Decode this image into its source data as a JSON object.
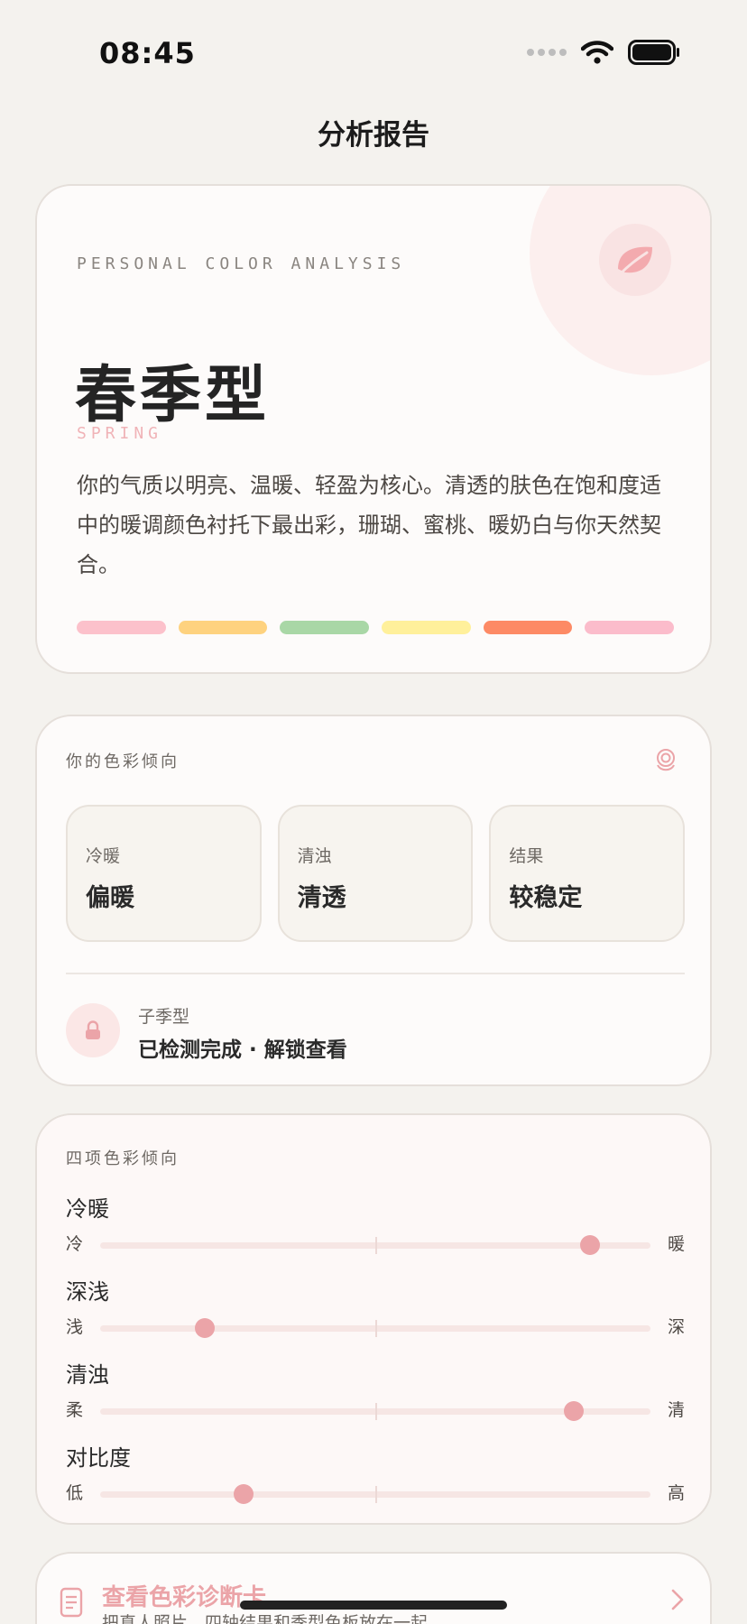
{
  "status": {
    "time": "08:45"
  },
  "nav": {
    "title": "分析报告"
  },
  "hero": {
    "eyebrow": "PERSONAL COLOR ANALYSIS",
    "season": "春季型",
    "season_en": "SPRING",
    "description": "你的气质以明亮、温暖、轻盈为核心。清透的肤色在饱和度适中的暖调颜色衬托下最出彩，珊瑚、蜜桃、暖奶白与你天然契合。",
    "swatches": [
      "#fcc1cb",
      "#fed27f",
      "#a9d7a6",
      "#fff09b",
      "#fd8a65",
      "#fbbccb"
    ]
  },
  "tendency": {
    "label": "你的色彩倾向",
    "stats": [
      {
        "label": "冷暖",
        "value": "偏暖"
      },
      {
        "label": "清浊",
        "value": "清透"
      },
      {
        "label": "结果",
        "value": "较稳定"
      }
    ],
    "sub_label": "子季型",
    "sub_value": "已检测完成 · 解锁查看"
  },
  "axes": {
    "label": "四项色彩倾向",
    "items": [
      {
        "name": "冷暖",
        "left": "冷",
        "right": "暖",
        "value": 0.89
      },
      {
        "name": "深浅",
        "left": "浅",
        "right": "深",
        "value": 0.19
      },
      {
        "name": "清浊",
        "left": "柔",
        "right": "清",
        "value": 0.86
      },
      {
        "name": "对比度",
        "left": "低",
        "right": "高",
        "value": 0.26
      }
    ]
  },
  "diagnostic": {
    "title": "查看色彩诊断卡",
    "subtitle": "把真人照片、四轴结果和季型色板放在一起"
  },
  "colors": {
    "accent": "#eba4a8",
    "background": "#f4f2ee"
  }
}
